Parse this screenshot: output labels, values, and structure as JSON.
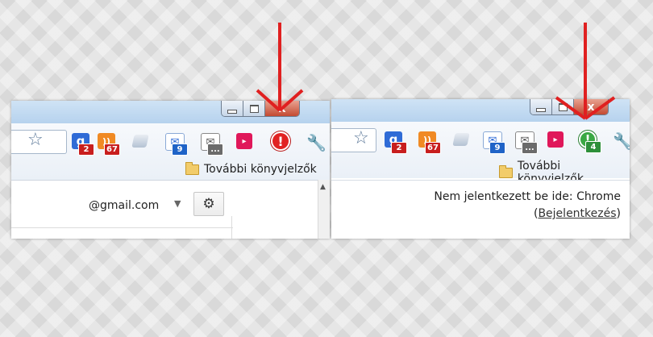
{
  "left_window": {
    "toolbar": {
      "icons": [
        {
          "name": "google-plus-icon",
          "badge": "2",
          "badge_color": "#c81e1e"
        },
        {
          "name": "rss-feed-icon",
          "badge": "67",
          "badge_color": "#c81e1e"
        },
        {
          "name": "calendar-icon",
          "badge": ""
        },
        {
          "name": "mail-icon",
          "badge": "9",
          "badge_color": "#1f63c7"
        },
        {
          "name": "mail-gray-icon",
          "badge": "...",
          "badge_color": "#6b6b6b"
        },
        {
          "name": "pink-extension-icon",
          "badge": ""
        },
        {
          "name": "red-alert-icon",
          "badge": ""
        },
        {
          "name": "wrench-icon",
          "badge": ""
        }
      ]
    },
    "bookmark_folder": "További könyvjelzők",
    "account_email": "@gmail.com",
    "window_buttons": {
      "close": "x"
    }
  },
  "right_window": {
    "toolbar": {
      "icons": [
        {
          "name": "google-plus-icon",
          "badge": "2",
          "badge_color": "#c81e1e"
        },
        {
          "name": "rss-feed-icon",
          "badge": "67",
          "badge_color": "#c81e1e"
        },
        {
          "name": "calendar-icon",
          "badge": ""
        },
        {
          "name": "mail-icon",
          "badge": "9",
          "badge_color": "#1f63c7"
        },
        {
          "name": "mail-gray-icon",
          "badge": "...",
          "badge_color": "#6b6b6b"
        },
        {
          "name": "pink-extension-icon",
          "badge": ""
        },
        {
          "name": "green-alert-icon",
          "badge": "4",
          "badge_color": "#2d8f3a"
        },
        {
          "name": "wrench-icon",
          "badge": ""
        }
      ]
    },
    "bookmark_folder": "További könyvjelzők",
    "signin_text": "Nem jelentkezett be ide: Chrome",
    "signin_link": "Bejelentkezés",
    "window_buttons": {
      "close": "x"
    }
  },
  "colors": {
    "arrow": "#e02020",
    "badge_red": "#c81e1e",
    "badge_blue": "#1f63c7",
    "badge_green": "#2d8f3a"
  }
}
